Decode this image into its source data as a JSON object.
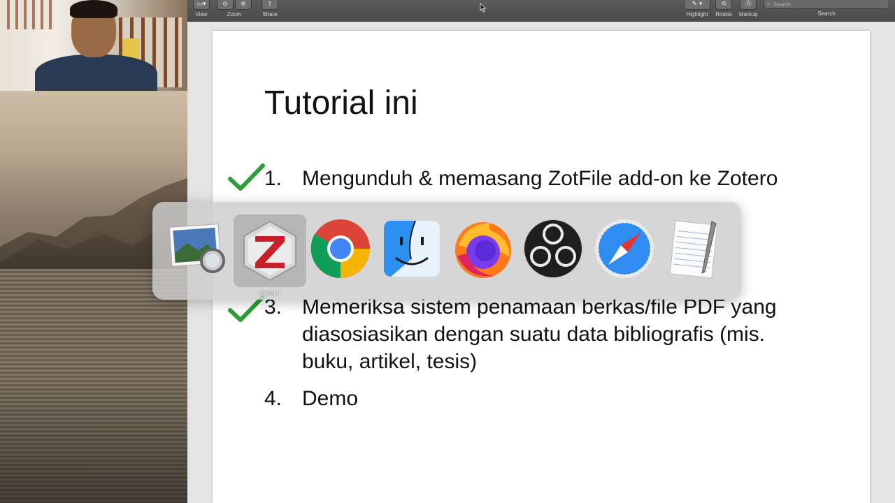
{
  "toolbar": {
    "view_label": "View",
    "zoom_label": "Zoom",
    "share_label": "Share",
    "highlight_label": "Highlight",
    "rotate_label": "Rotate",
    "markup_label": "Markup",
    "search_label": "Search",
    "search_placeholder": "Search"
  },
  "slide": {
    "title": "Tutorial ini",
    "items": [
      {
        "num": "1.",
        "text": "Mengunduh & memasang ZotFile add-on ke Zotero",
        "checked": true
      },
      {
        "num": "3.",
        "text": "Memeriksa sistem penamaan berkas/file PDF yang diasosiasikan dengan suatu data bibliografis (mis. buku, artikel, tesis)",
        "checked": true
      },
      {
        "num": "4.",
        "text": "Demo",
        "checked": false
      }
    ]
  },
  "app_switcher": {
    "selected_label": "Zotero",
    "apps": [
      "preview-icon",
      "zotero-icon",
      "chrome-icon",
      "finder-icon",
      "firefox-icon",
      "obs-icon",
      "safari-icon",
      "textedit-icon"
    ]
  },
  "colors": {
    "check": "#2f9e3a",
    "zotero_red": "#c8202b",
    "toolbar": "#4f4f4f"
  }
}
